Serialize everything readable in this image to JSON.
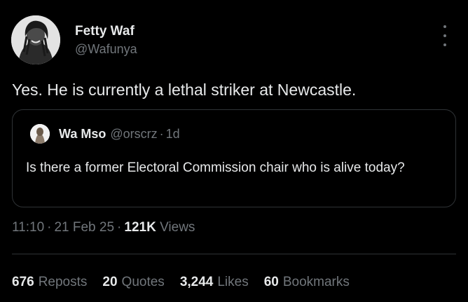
{
  "author": {
    "name": "Fetty Waf",
    "handle": "@Wafunya"
  },
  "tweet": {
    "text": "Yes. He is currently a lethal striker at Newcastle."
  },
  "quoted": {
    "name": "Wa Mso",
    "handle": "@orscrz",
    "dot": "·",
    "time": "1d",
    "text": "Is there a former Electoral Commission chair who is alive today?"
  },
  "meta": {
    "time": "11:10",
    "dot1": "·",
    "date": "21 Feb 25",
    "dot2": "·",
    "views_count": "121K",
    "views_label": "Views"
  },
  "stats": {
    "reposts": {
      "num": "676",
      "label": "Reposts"
    },
    "quotes": {
      "num": "20",
      "label": "Quotes"
    },
    "likes": {
      "num": "3,244",
      "label": "Likes"
    },
    "bookmarks": {
      "num": "60",
      "label": "Bookmarks"
    }
  },
  "icons": {
    "more": "more-vertical-icon"
  },
  "colors": {
    "background": "#000000",
    "primary_text": "#e7e9ea",
    "secondary_text": "#71767b",
    "border": "#2f3336"
  }
}
